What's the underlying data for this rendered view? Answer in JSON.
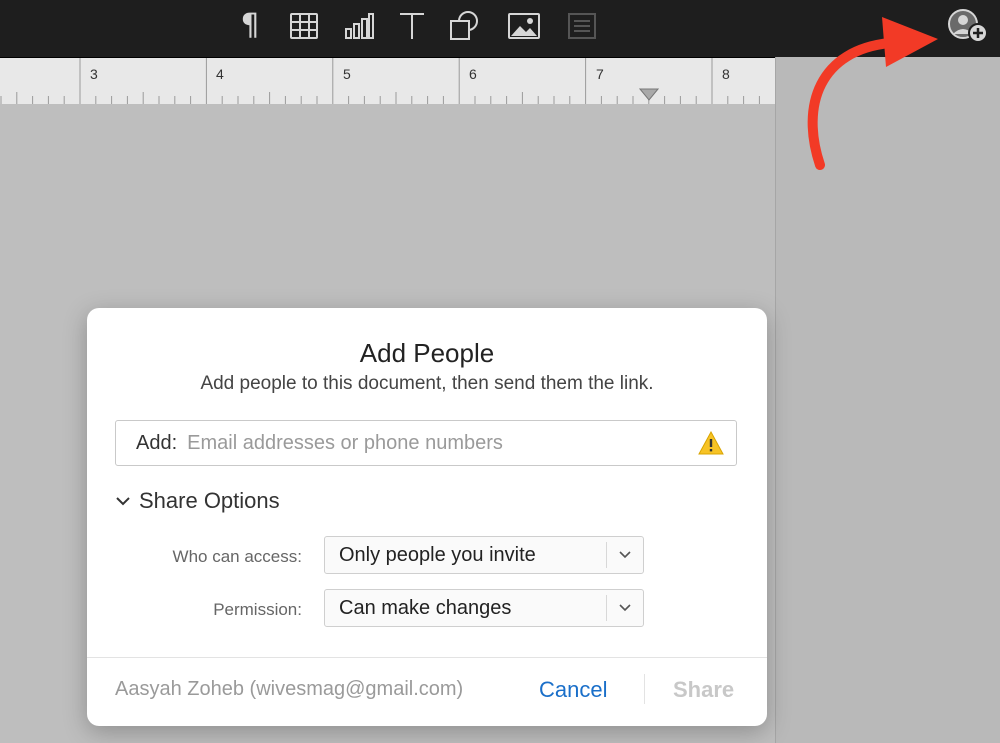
{
  "toolbar": {
    "icons": [
      "paragraph-icon",
      "table-icon",
      "chart-icon",
      "text-icon",
      "shape-icon",
      "image-icon",
      "comment-icon"
    ],
    "paragraph_glyph": "¶"
  },
  "collaborate": {
    "icon": "add-person-icon"
  },
  "ruler": {
    "numbers": [
      "3",
      "4",
      "5",
      "6",
      "7",
      "8"
    ]
  },
  "colors": {
    "toolbar_bg": "#1e1e1e",
    "accent_blue": "#1a6fc9",
    "arrow_red": "#f23a26",
    "warning_yellow": "#f7c325"
  },
  "dialog": {
    "title": "Add People",
    "subtitle": "Add people to this document, then send them the link.",
    "add_label": "Add:",
    "add_placeholder": "Email addresses or phone numbers",
    "share_options_label": "Share Options",
    "who_can_access_label": "Who can access:",
    "who_can_access_value": "Only people you invite",
    "permission_label": "Permission:",
    "permission_value": "Can make changes",
    "owner": "Aasyah Zoheb (wivesmag@gmail.com)",
    "cancel_label": "Cancel",
    "share_label": "Share"
  }
}
